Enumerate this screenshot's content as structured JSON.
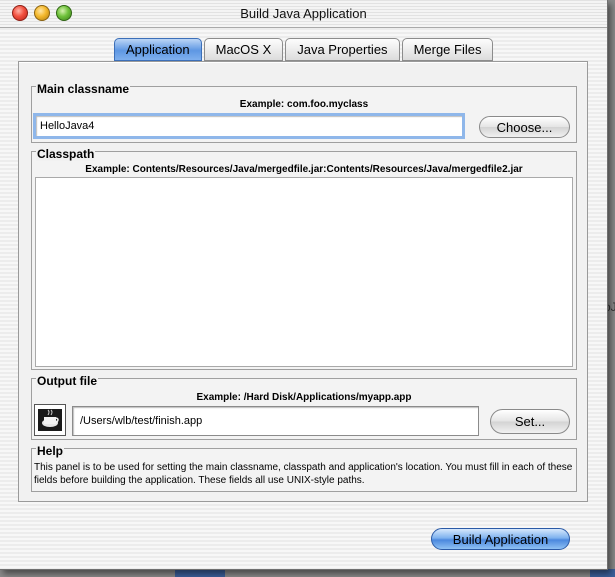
{
  "window": {
    "title": "Build Java Application"
  },
  "tabs": [
    {
      "label": "Application",
      "active": true
    },
    {
      "label": "MacOS X",
      "active": false
    },
    {
      "label": "Java Properties",
      "active": false
    },
    {
      "label": "Merge Files",
      "active": false
    }
  ],
  "main_classname": {
    "heading": "Main classname",
    "example": "Example: com.foo.myclass",
    "value": "HelloJava4",
    "button": "Choose..."
  },
  "classpath": {
    "heading": "Classpath",
    "example": "Example: Contents/Resources/Java/mergedfile.jar:Contents/Resources/Java/mergedfile2.jar"
  },
  "output_file": {
    "heading": "Output file",
    "example": "Example: /Hard Disk/Applications/myapp.app",
    "value": "/Users/wlb/test/finish.app",
    "button": "Set...",
    "icon": "application-file-icon"
  },
  "help": {
    "heading": "Help",
    "text": "This panel is to be used for setting the main classname, classpath and application's location. You must fill in each of these fields before building the application. These fields all use UNIX-style paths."
  },
  "footer": {
    "build_button": "Build Application"
  },
  "background": {
    "fragment_text": "oJa"
  },
  "colors": {
    "accent": "#5e97e3",
    "focus_ring": "#8fb7ea"
  }
}
